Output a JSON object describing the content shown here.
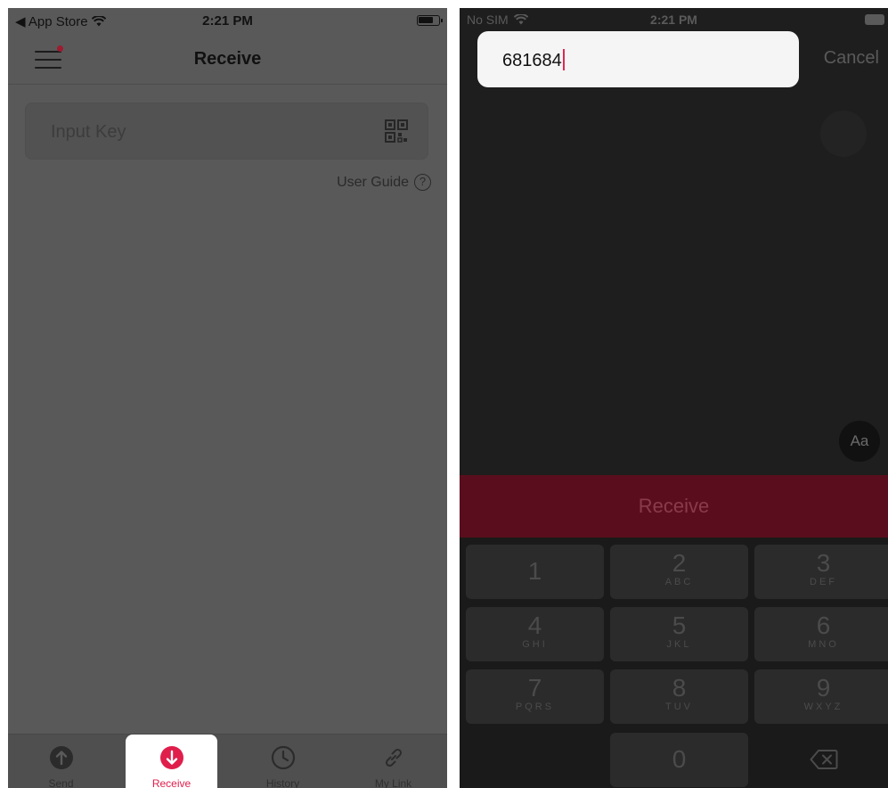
{
  "left": {
    "status": {
      "back_label": "◀ App Store",
      "time": "2:21 PM"
    },
    "nav": {
      "title": "Receive"
    },
    "input": {
      "placeholder": "Input Key"
    },
    "guide": {
      "label": "User Guide",
      "help_glyph": "?"
    },
    "tabs": [
      {
        "label": "Send",
        "icon": "arrow-up-circle-icon"
      },
      {
        "label": "Receive",
        "icon": "arrow-down-circle-icon",
        "active": true
      },
      {
        "label": "History",
        "icon": "clock-icon"
      },
      {
        "label": "My Link",
        "icon": "link-icon"
      }
    ]
  },
  "right": {
    "status": {
      "carrier": "No SIM",
      "time": "2:21 PM"
    },
    "field": {
      "value": "681684"
    },
    "cancel_label": "Cancel",
    "aa_label": "Aa",
    "receive_label": "Receive",
    "keys": [
      {
        "num": "1",
        "letters": ""
      },
      {
        "num": "2",
        "letters": "ABC"
      },
      {
        "num": "3",
        "letters": "DEF"
      },
      {
        "num": "4",
        "letters": "GHI"
      },
      {
        "num": "5",
        "letters": "JKL"
      },
      {
        "num": "6",
        "letters": "MNO"
      },
      {
        "num": "7",
        "letters": "PQRS"
      },
      {
        "num": "8",
        "letters": "TUV"
      },
      {
        "num": "9",
        "letters": "WXYZ"
      },
      {
        "num": "0",
        "letters": ""
      }
    ]
  },
  "colors": {
    "accent": "#e01e4b",
    "dim_overlay": "#595959",
    "dark_bg": "#1e1e1e"
  }
}
